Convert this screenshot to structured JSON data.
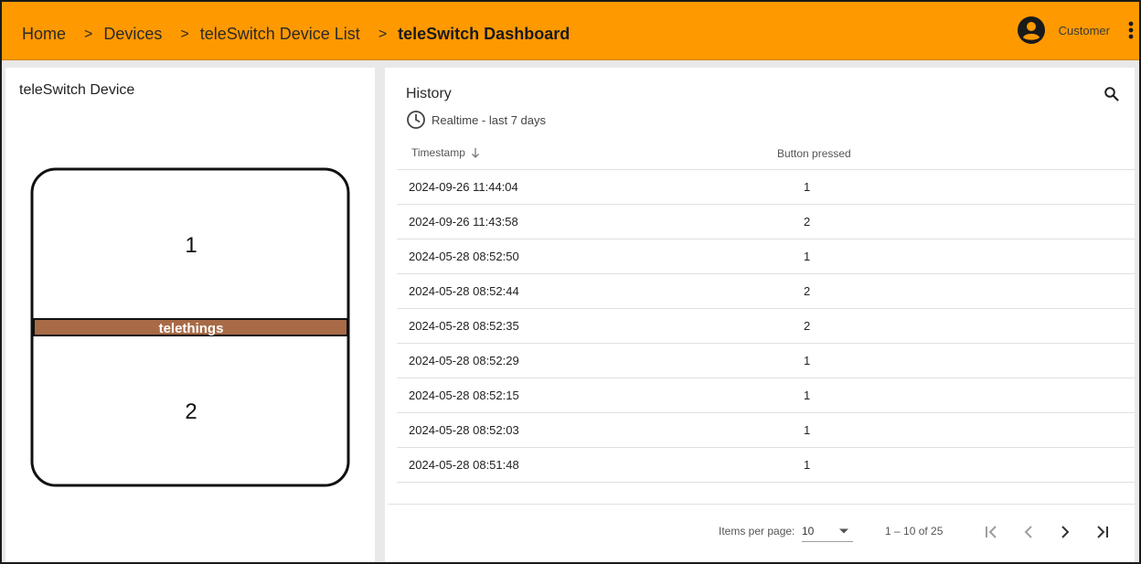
{
  "header": {
    "breadcrumb": [
      "Home",
      "Devices",
      "teleSwitch Device List"
    ],
    "separator": ">",
    "current": "teleSwitch Dashboard",
    "user_label": "Customer",
    "accent_color": "#ff9900",
    "icons": {
      "avatar": "account-circle-icon",
      "menu": "more-vertical-icon"
    }
  },
  "device_panel": {
    "title": "teleSwitch Device",
    "button_top_label": "1",
    "button_bottom_label": "2",
    "brand_label": "telethings",
    "brand_color": "#a86a47"
  },
  "history": {
    "title": "History",
    "timewindow": "Realtime - last 7 days",
    "columns": [
      "Timestamp",
      "Button pressed"
    ],
    "rows": [
      [
        "2024-09-26 11:44:04",
        "1"
      ],
      [
        "2024-09-26 11:43:58",
        "2"
      ],
      [
        "2024-05-28 08:52:50",
        "1"
      ],
      [
        "2024-05-28 08:52:44",
        "2"
      ],
      [
        "2024-05-28 08:52:35",
        "2"
      ],
      [
        "2024-05-28 08:52:29",
        "1"
      ],
      [
        "2024-05-28 08:52:15",
        "1"
      ],
      [
        "2024-05-28 08:52:03",
        "1"
      ],
      [
        "2024-05-28 08:51:48",
        "1"
      ]
    ],
    "pagination": {
      "items_per_page_label": "Items per page:",
      "items_per_page": "10",
      "range": "1 – 10 of 25"
    }
  }
}
